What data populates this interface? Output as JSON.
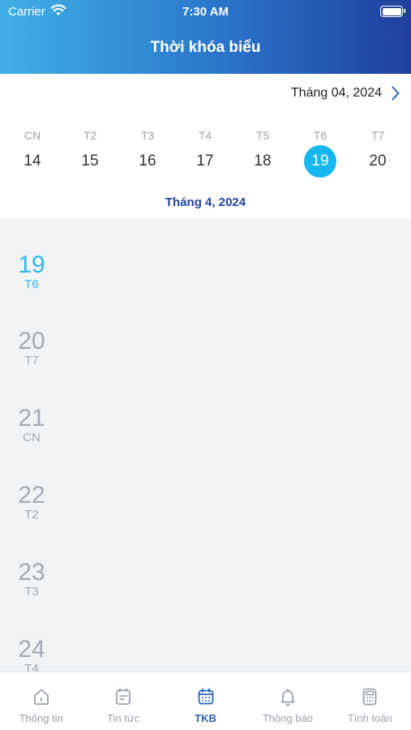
{
  "status_bar": {
    "carrier": "Carrier",
    "time": "7:30 AM"
  },
  "header": {
    "title": "Thời khóa biểu"
  },
  "calendar": {
    "month_label": "Tháng 04, 2024",
    "week": [
      {
        "dow": "CN",
        "date": "14"
      },
      {
        "dow": "T2",
        "date": "15"
      },
      {
        "dow": "T3",
        "date": "16"
      },
      {
        "dow": "T4",
        "date": "17"
      },
      {
        "dow": "T5",
        "date": "18"
      },
      {
        "dow": "T6",
        "date": "19",
        "selected": true
      },
      {
        "dow": "T7",
        "date": "20"
      }
    ],
    "current_month": "Tháng 4, 2024"
  },
  "timeline": [
    {
      "date": "19",
      "dow": "T6",
      "active": true
    },
    {
      "date": "20",
      "dow": "T7"
    },
    {
      "date": "21",
      "dow": "CN"
    },
    {
      "date": "22",
      "dow": "T2"
    },
    {
      "date": "23",
      "dow": "T3"
    },
    {
      "date": "24",
      "dow": "T4"
    }
  ],
  "tabs": [
    {
      "label": "Thông tin",
      "icon": "info-icon"
    },
    {
      "label": "Tin tức",
      "icon": "news-icon"
    },
    {
      "label": "TKB",
      "icon": "calendar-icon",
      "active": true
    },
    {
      "label": "Thông báo",
      "icon": "bell-icon"
    },
    {
      "label": "Tính toán",
      "icon": "calculator-icon"
    }
  ],
  "colors": {
    "accent": "#16b7ee",
    "active_tab": "#2a63b8",
    "muted": "#9aa1a9",
    "month_text": "#23449a"
  }
}
